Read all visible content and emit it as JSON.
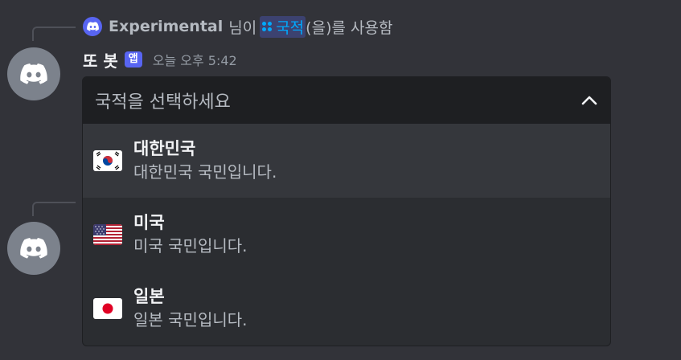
{
  "messages": [
    {
      "reply": {
        "user": "Experimental",
        "text_before": "님이",
        "command": "국적",
        "text_after": "(을)를 사용함"
      },
      "author": "또 봇",
      "badge": "앱",
      "timestamp": "오늘 오후 5:42"
    }
  ],
  "select_menu": {
    "placeholder": "국적을 선택하세요",
    "options": [
      {
        "label": "대한민국",
        "description": "대한민국 국민입니다.",
        "flag": "kr-flag-icon",
        "selected": true
      },
      {
        "label": "미국",
        "description": "미국 국민입니다.",
        "flag": "us-flag-icon",
        "selected": false
      },
      {
        "label": "일본",
        "description": "일본 국민입니다.",
        "flag": "jp-flag-icon",
        "selected": false
      }
    ]
  },
  "colors": {
    "background": "#323339",
    "accent": "#5865f2",
    "link": "#00a8fc",
    "avatar": "#7c828c"
  }
}
